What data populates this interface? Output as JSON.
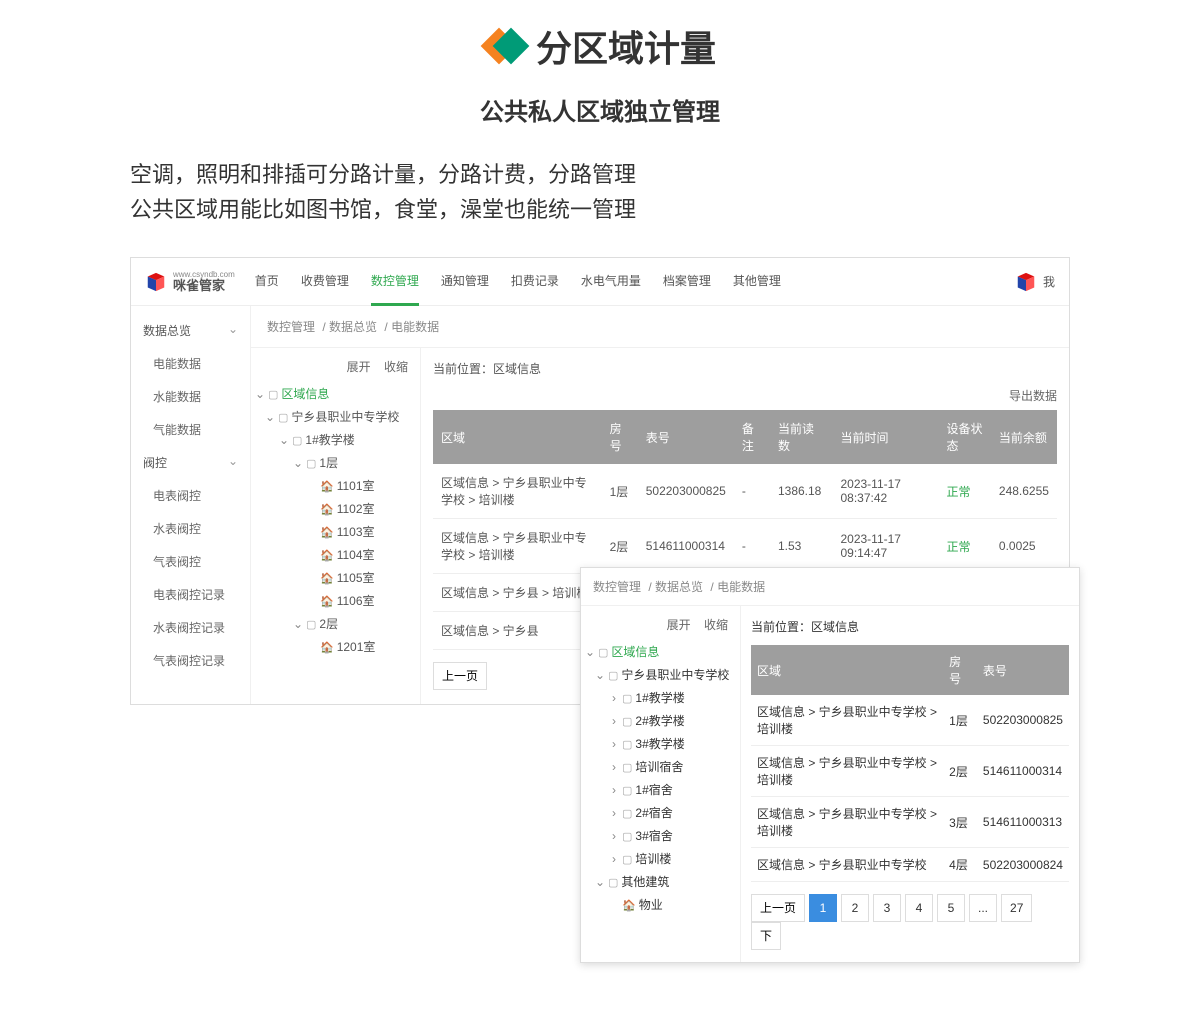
{
  "hero": {
    "title": "分区域计量",
    "subtitle": "公共私人区域独立管理"
  },
  "desc": {
    "line1": "空调，照明和排插可分路计量，分路计费，分路管理",
    "line2": "公共区域用能比如图书馆，食堂，澡堂也能统一管理"
  },
  "brand": {
    "cn": "咪雀管家",
    "en": "www.csyndb.com"
  },
  "nav": [
    "首页",
    "收费管理",
    "数控管理",
    "通知管理",
    "扣费记录",
    "水电气用量",
    "档案管理",
    "其他管理"
  ],
  "nav_active": 2,
  "user_label": "我",
  "sidebar": {
    "groups": [
      {
        "label": "数据总览",
        "open": true,
        "items": [
          "电能数据",
          "水能数据",
          "气能数据"
        ]
      },
      {
        "label": "阀控",
        "open": true,
        "items": [
          "电表阀控",
          "水表阀控",
          "气表阀控",
          "电表阀控记录",
          "水表阀控记录",
          "气表阀控记录"
        ]
      }
    ]
  },
  "crumb": [
    "数控管理",
    "数据总览",
    "电能数据"
  ],
  "tree_actions": {
    "expand": "展开",
    "collapse": "收缩"
  },
  "location": {
    "label": "当前位置：",
    "value": "区域信息"
  },
  "export_label": "导出数据",
  "tree1": {
    "root": "区域信息",
    "school": "宁乡县职业中专学校",
    "b1": "1#教学楼",
    "f1": "1层",
    "rooms1": [
      "1101室",
      "1102室",
      "1103室",
      "1104室",
      "1105室",
      "1106室"
    ],
    "f2": "2层",
    "rooms2": [
      "1201室"
    ]
  },
  "table1": {
    "headers": [
      "区域",
      "房号",
      "表号",
      "备注",
      "当前读数",
      "当前时间",
      "设备状态",
      "当前余额"
    ],
    "rows": [
      {
        "area": "区域信息 > 宁乡县职业中专学校 > 培训楼",
        "room": "1层",
        "meter": "502203000825",
        "note": "-",
        "reading": "1386.18",
        "time": "2023-11-17 08:37:42",
        "status": "正常",
        "balance": "248.6255"
      },
      {
        "area": "区域信息 > 宁乡县职业中专学校 > 培训楼",
        "room": "2层",
        "meter": "514611000314",
        "note": "-",
        "reading": "1.53",
        "time": "2023-11-17 09:14:47",
        "status": "正常",
        "balance": "0.0025"
      }
    ],
    "partial": [
      "区域信息 > 宁乡县 > 培训楼",
      "区域信息 > 宁乡县"
    ]
  },
  "pager1": {
    "prev": "上一页"
  },
  "shot2": {
    "crumb": [
      "数控管理",
      "数据总览",
      "电能数据"
    ],
    "location": {
      "label": "当前位置：",
      "value": "区域信息"
    },
    "tree": {
      "root": "区域信息",
      "school": "宁乡县职业中专学校",
      "items": [
        "1#教学楼",
        "2#教学楼",
        "3#教学楼",
        "培训宿舍",
        "1#宿舍",
        "2#宿舍",
        "3#宿舍",
        "培训楼"
      ],
      "other_group": "其他建筑",
      "other_item": "物业"
    },
    "table": {
      "headers": [
        "区域",
        "房号",
        "表号"
      ],
      "rows": [
        {
          "area": "区域信息 > 宁乡县职业中专学校 > 培训楼",
          "room": "1层",
          "meter": "502203000825"
        },
        {
          "area": "区域信息 > 宁乡县职业中专学校 > 培训楼",
          "room": "2层",
          "meter": "514611000314"
        },
        {
          "area": "区域信息 > 宁乡县职业中专学校 > 培训楼",
          "room": "3层",
          "meter": "514611000313"
        },
        {
          "area": "区域信息 > 宁乡县职业中专学校",
          "room": "4层",
          "meter": "502203000824"
        }
      ]
    },
    "pager": {
      "prev": "上一页",
      "pages": [
        "1",
        "2",
        "3",
        "4",
        "5",
        "...",
        "27"
      ],
      "next": "下"
    }
  }
}
